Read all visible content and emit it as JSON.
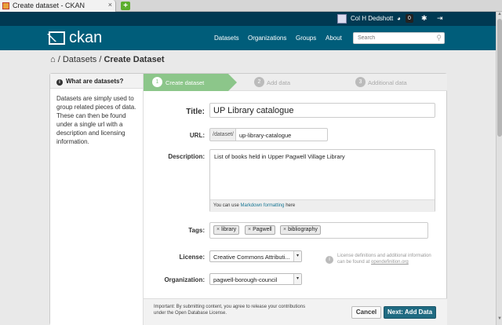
{
  "browser": {
    "tab_title": "Create dataset - CKAN",
    "tab_close": "×",
    "new_tab": "+"
  },
  "account": {
    "username": "Col H Dedshott",
    "dashboard_icon": "dashboard-icon",
    "dashboard_count": "0",
    "settings_icon": "gear-icon",
    "logout_icon": "logout-icon"
  },
  "masthead": {
    "logo": "ckan",
    "nav": [
      "Datasets",
      "Organizations",
      "Groups",
      "About"
    ],
    "search_placeholder": "Search"
  },
  "breadcrumb": {
    "home_icon": "home-icon",
    "items": [
      "Datasets",
      "Create Dataset"
    ]
  },
  "aside": {
    "heading": "What are datasets?",
    "body": "Datasets are simply used to group related pieces of data. These can then be found under a single url with a description and licensing information."
  },
  "stages": [
    {
      "num": "1",
      "label": "Create dataset"
    },
    {
      "num": "2",
      "label": "Add data"
    },
    {
      "num": "3",
      "label": "Additional data"
    }
  ],
  "form": {
    "title_label": "Title:",
    "title_value": "UP Library catalogue",
    "url_label": "URL:",
    "url_prefix": "/dataset/",
    "url_value": "up-library-catalogue",
    "description_label": "Description:",
    "description_value": "List of books held in Upper Pagwell Village Library",
    "markdown_prefix": "You can use",
    "markdown_link": "Markdown formatting",
    "markdown_suffix": "here",
    "tags_label": "Tags:",
    "tags": [
      "library",
      "Pagwell",
      "bibliography"
    ],
    "license_label": "License:",
    "license_value": "Creative Commons Attributi...",
    "license_help": "License definitions and additional information can be found at",
    "license_help_link": "opendefinition.org",
    "organization_label": "Organization:",
    "organization_value": "pagwell-borough-council"
  },
  "actions": {
    "notice": "Important: By submitting content, you agree to release your contributions under the Open Database License.",
    "cancel": "Cancel",
    "next": "Next: Add Data"
  },
  "colors": {
    "masthead": "#005d7a",
    "account_bar": "#003952",
    "stage_active": "#8cc68a",
    "primary_button": "#206b82"
  }
}
